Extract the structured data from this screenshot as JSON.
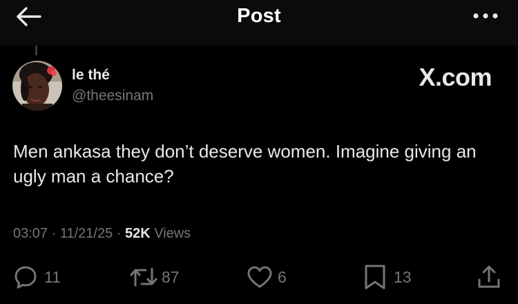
{
  "header": {
    "title": "Post",
    "back_icon": "arrow-left-icon",
    "more_icon": "more-horizontal-icon"
  },
  "post": {
    "author": {
      "name": "le thé",
      "handle": "@theesinam"
    },
    "watermark": "X.com",
    "text": "Men ankasa they don’t deserve women. Imagine giving an ugly man a chance?",
    "time": "03:07",
    "separator": "·",
    "date": "11/21/25",
    "views_count": "52K",
    "views_label": "Views"
  },
  "actions": {
    "replies": "11",
    "reposts": "87",
    "likes": "6",
    "bookmarks": "13"
  },
  "colors": {
    "background": "#000000",
    "header_bg": "#0b0b0b",
    "text_primary": "#e7e9ea",
    "text_secondary": "#71767b"
  }
}
